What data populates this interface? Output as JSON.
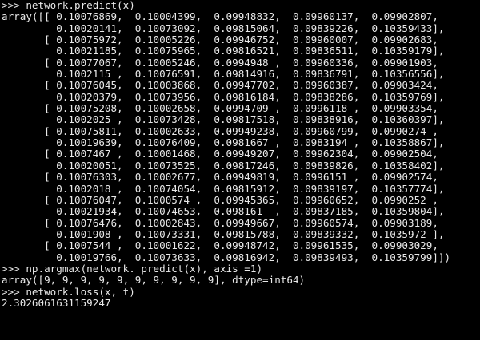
{
  "terminal": {
    "lines": [
      ">>> network.predict(x)",
      "array([[ 0.10076869,  0.10004399,  0.09948832,  0.09960137,  0.09902807,",
      "         0.10020141,  0.10073092,  0.09815064,  0.09839226,  0.10359433],",
      "       [ 0.10075972,  0.10005226,  0.09946752,  0.09960007,  0.09902683,",
      "         0.10021185,  0.10075965,  0.09816521,  0.09836511,  0.10359179],",
      "       [ 0.10077067,  0.10005246,  0.0994948 ,  0.09960336,  0.09901903,",
      "         0.1002115 ,  0.10076591,  0.09814916,  0.09836791,  0.10356556],",
      "       [ 0.10076045,  0.10003868,  0.09947702,  0.09960387,  0.09903424,",
      "         0.10020379,  0.10073956,  0.09816184,  0.09838286,  0.10359769],",
      "       [ 0.10075208,  0.10002658,  0.0994709 ,  0.0996118 ,  0.09903354,",
      "         0.1002025 ,  0.10073428,  0.09817518,  0.09838916,  0.10360397],",
      "       [ 0.10075811,  0.10002633,  0.09949238,  0.09960799,  0.0990274 ,",
      "         0.10019639,  0.10076409,  0.0981667 ,  0.0983194 ,  0.10358867],",
      "       [ 0.1007467 ,  0.10001468,  0.09949207,  0.09962304,  0.09902504,",
      "         0.10020051,  0.10073525,  0.09817246,  0.09839826,  0.10358402],",
      "       [ 0.10076303,  0.10002677,  0.09949819,  0.0996151 ,  0.09902574,",
      "         0.1002018 ,  0.10074054,  0.09815912,  0.09839197,  0.10357774],",
      "       [ 0.10076047,  0.1000574 ,  0.09945365,  0.09960652,  0.0990252 ,",
      "         0.10021934,  0.10074653,  0.098161  ,  0.09837185,  0.10359804],",
      "       [ 0.10076476,  0.10002843,  0.09949667,  0.09960574,  0.09903189,",
      "         0.1001908 ,  0.10073331,  0.09815788,  0.09839332,  0.1035972 ],",
      "       [ 0.1007544 ,  0.10001622,  0.09948742,  0.09961535,  0.09903029,",
      "         0.10019766,  0.10073633,  0.09816942,  0.09839493,  0.10359799]])",
      ">>> np.argmax(network. predict(x), axis =1)",
      "array([9, 9, 9, 9, 9, 9, 9, 9, 9, 9], dtype=int64)",
      ">>> network.loss(x, t)",
      "2.3026061631159247"
    ]
  }
}
